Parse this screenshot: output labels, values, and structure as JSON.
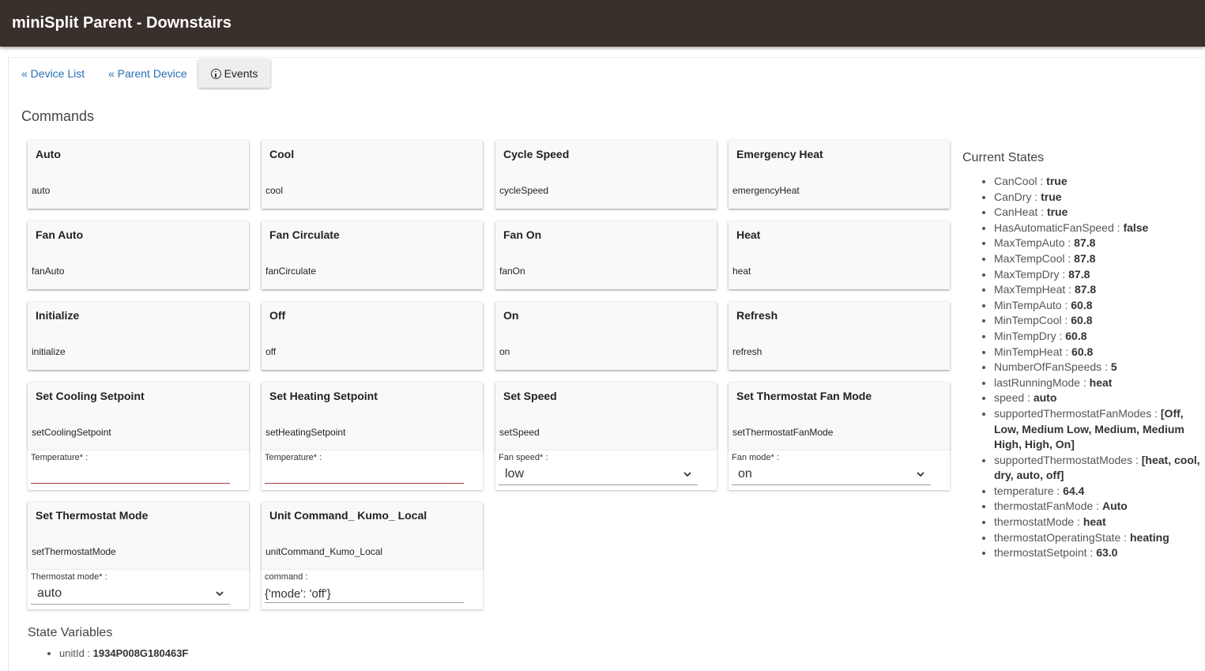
{
  "header": {
    "title": "miniSplit Parent - Downstairs"
  },
  "nav": {
    "device_list": "« Device List",
    "parent_device": "« Parent Device",
    "events": "Events"
  },
  "commands_title": "Commands",
  "commands": [
    {
      "name": "Auto",
      "command": "auto"
    },
    {
      "name": "Cool",
      "command": "cool"
    },
    {
      "name": "Cycle Speed",
      "command": "cycleSpeed"
    },
    {
      "name": "Emergency Heat",
      "command": "emergencyHeat"
    },
    {
      "name": "Fan Auto",
      "command": "fanAuto"
    },
    {
      "name": "Fan Circulate",
      "command": "fanCirculate"
    },
    {
      "name": "Fan On",
      "command": "fanOn"
    },
    {
      "name": "Heat",
      "command": "heat"
    },
    {
      "name": "Initialize",
      "command": "initialize"
    },
    {
      "name": "Off",
      "command": "off"
    },
    {
      "name": "On",
      "command": "on"
    },
    {
      "name": "Refresh",
      "command": "refresh"
    },
    {
      "name": "Set Cooling Setpoint",
      "command": "setCoolingSetpoint",
      "param": {
        "label": "Temperature* :",
        "type": "number",
        "value": ""
      }
    },
    {
      "name": "Set Heating Setpoint",
      "command": "setHeatingSetpoint",
      "param": {
        "label": "Temperature* :",
        "type": "number",
        "value": ""
      }
    },
    {
      "name": "Set Speed",
      "command": "setSpeed",
      "param": {
        "label": "Fan speed* :",
        "type": "select",
        "value": "low"
      }
    },
    {
      "name": "Set Thermostat Fan Mode",
      "command": "setThermostatFanMode",
      "param": {
        "label": "Fan mode* :",
        "type": "select",
        "value": "on"
      }
    },
    {
      "name": "Set Thermostat Mode",
      "command": "setThermostatMode",
      "param": {
        "label": "Thermostat mode* :",
        "type": "select",
        "value": "auto"
      }
    },
    {
      "name": "Unit Command_ Kumo_ Local",
      "command": "unitCommand_Kumo_Local",
      "param": {
        "label": "command :",
        "type": "text",
        "value": "{'mode': 'off'}"
      }
    }
  ],
  "current_states_title": "Current States",
  "current_states": [
    {
      "key": "CanCool",
      "value": "true"
    },
    {
      "key": "CanDry",
      "value": "true"
    },
    {
      "key": "CanHeat",
      "value": "true"
    },
    {
      "key": "HasAutomaticFanSpeed",
      "value": "false"
    },
    {
      "key": "MaxTempAuto",
      "value": "87.8"
    },
    {
      "key": "MaxTempCool",
      "value": "87.8"
    },
    {
      "key": "MaxTempDry",
      "value": "87.8"
    },
    {
      "key": "MaxTempHeat",
      "value": "87.8"
    },
    {
      "key": "MinTempAuto",
      "value": "60.8"
    },
    {
      "key": "MinTempCool",
      "value": "60.8"
    },
    {
      "key": "MinTempDry",
      "value": "60.8"
    },
    {
      "key": "MinTempHeat",
      "value": "60.8"
    },
    {
      "key": "NumberOfFanSpeeds",
      "value": "5"
    },
    {
      "key": "lastRunningMode",
      "value": "heat"
    },
    {
      "key": "speed",
      "value": "auto"
    },
    {
      "key": "supportedThermostatFanModes",
      "value": "[Off, Low, Medium Low, Medium, Medium High, High, On]"
    },
    {
      "key": "supportedThermostatModes",
      "value": "[heat, cool, dry, auto, off]"
    },
    {
      "key": "temperature",
      "value": "64.4"
    },
    {
      "key": "thermostatFanMode",
      "value": "Auto"
    },
    {
      "key": "thermostatMode",
      "value": "heat"
    },
    {
      "key": "thermostatOperatingState",
      "value": "heating"
    },
    {
      "key": "thermostatSetpoint",
      "value": "63.0"
    }
  ],
  "state_variables_title": "State Variables",
  "state_variables": [
    {
      "key": "unitId",
      "value": "1934P008G180463F"
    }
  ],
  "icons": {
    "events": "info-icon",
    "select": "chevron-down-icon"
  }
}
